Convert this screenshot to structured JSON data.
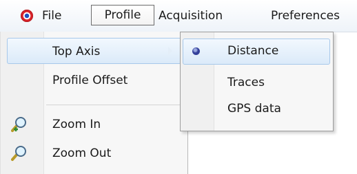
{
  "menubar": {
    "items": [
      "File",
      "Profile",
      "Acquisition",
      "Preferences"
    ]
  },
  "profile_menu": {
    "items": [
      {
        "label": "Top Axis",
        "has_submenu": true,
        "highlighted": true
      },
      {
        "label": "Profile Offset"
      },
      {
        "label": "Zoom In",
        "icon": "zoom-in-icon"
      },
      {
        "label": "Zoom Out",
        "icon": "zoom-out-icon"
      }
    ]
  },
  "top_axis_submenu": {
    "items": [
      {
        "label": "Distance",
        "selected": true
      },
      {
        "label": "Traces"
      },
      {
        "label": "GPS data"
      }
    ]
  },
  "colors": {
    "highlight_border": "#a7c8ea",
    "highlight_fill": "#dbeaf9",
    "radio_dot": "#34409a"
  }
}
